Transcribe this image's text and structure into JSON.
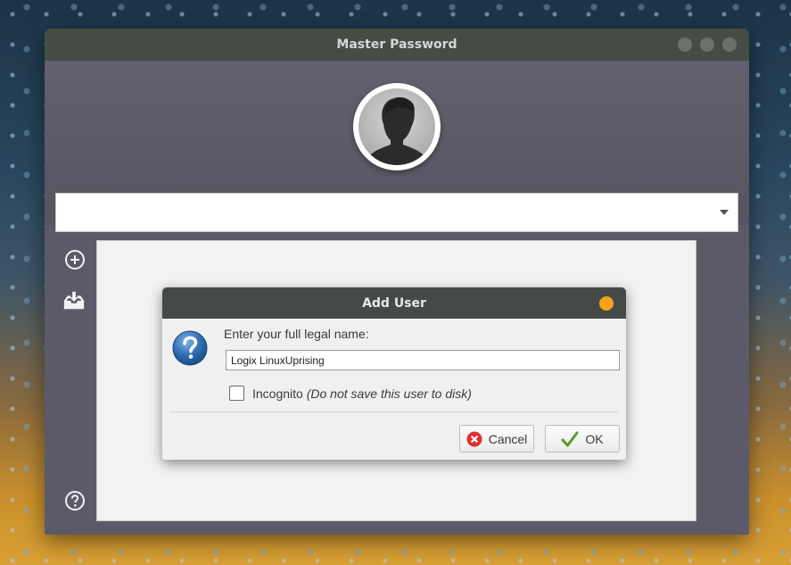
{
  "window": {
    "title": "Master Password"
  },
  "user_select": {
    "value": ""
  },
  "sidebar": {
    "icons": [
      "add-user-icon",
      "import-icon",
      "help-icon"
    ]
  },
  "dialog": {
    "title": "Add User",
    "prompt": "Enter your full legal name:",
    "name_value": "Logix LinuxUprising",
    "incognito_label": "Incognito",
    "incognito_note": "(Do not save this user to disk)",
    "incognito_checked": false,
    "cancel_label": "Cancel",
    "ok_label": "OK"
  },
  "colors": {
    "titlebar": "#454c46",
    "window_body": "#5b5a68",
    "dialog_dot": "#f4a31b",
    "cancel_icon": "#e03030",
    "ok_check": "#5a9a2a",
    "question_icon": "#2f6db0"
  }
}
